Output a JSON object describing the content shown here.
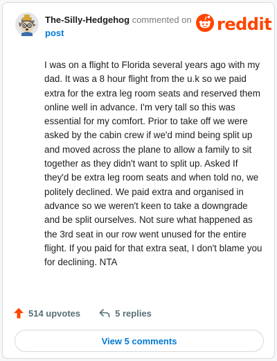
{
  "comment": {
    "author": "The-Silly-Hedgehog",
    "action_text": "commented on",
    "target_link": "post",
    "body": "I was on a flight to Florida several years ago with my dad. It was a 8 hour flight from the u.k so we paid extra for the extra leg room seats and reserved them online well in advance. I'm very tall so this was essential for my comfort. Prior to take off we were asked by the cabin crew if we'd mind being split up and moved across the plane to allow a family to sit together as they didn't want to split up. Asked If they'd be extra leg room seats and when told no, we politely declined. We paid extra and organised in advance so we weren't keen to take a downgrade and be split ourselves. Not sure what happened as the 3rd seat in our row went unused for the entire flight. If you paid for that extra seat, I don't blame you for declining. NTA",
    "avatar_icon": "hedgehog-avatar-icon"
  },
  "brand": {
    "wordmark": "reddit",
    "icon": "reddit-alien-icon",
    "color": "#ff4500"
  },
  "actions": {
    "upvotes_label": "514 upvotes",
    "upvote_icon": "upvote-arrow-icon",
    "upvote_color": "#ff4500",
    "replies_label": "5 replies",
    "reply_icon": "reply-arrow-icon"
  },
  "footer": {
    "view_comments_label": "View 5 comments"
  },
  "colors": {
    "link": "#0079d3",
    "muted": "#576f76",
    "text": "#1c1c1c"
  }
}
